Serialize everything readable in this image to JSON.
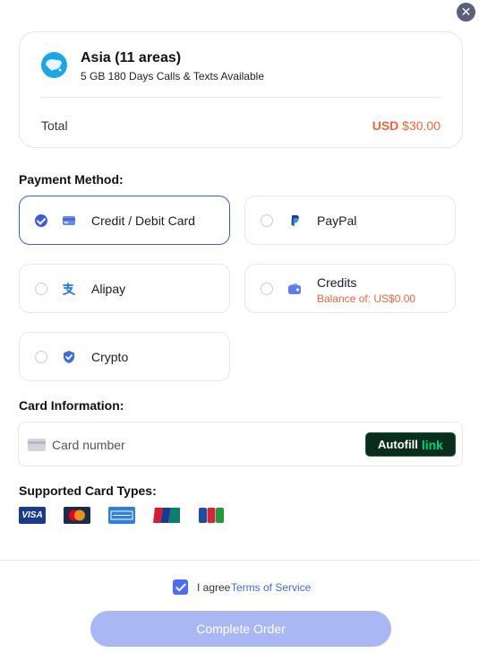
{
  "dialog": {
    "close_icon": "close-icon"
  },
  "summary": {
    "region_icon": "asia-map-icon",
    "region_title": "Asia (11 areas)",
    "plan_description": "5 GB 180 Days Calls & Texts Available",
    "total_label": "Total",
    "total_currency": "USD",
    "total_amount": "$30.00"
  },
  "payment": {
    "title": "Payment Method:",
    "methods": [
      {
        "label": "Credit / Debit Card",
        "icon": "credit-card-icon",
        "selected": true
      },
      {
        "label": "PayPal",
        "icon": "paypal-icon",
        "selected": false
      },
      {
        "label": "Alipay",
        "icon": "alipay-icon",
        "selected": false
      },
      {
        "label": "Credits",
        "sub_label": "Balance of: US$0.00",
        "icon": "wallet-icon",
        "selected": false
      },
      {
        "label": "Crypto",
        "icon": "shield-icon",
        "selected": false
      }
    ]
  },
  "card_info": {
    "title": "Card Information:",
    "placeholder": "Card number",
    "autofill_label": "Autofill",
    "autofill_brand": "link"
  },
  "card_types": {
    "title": "Supported Card Types:",
    "brands": [
      "VISA",
      "MasterCard",
      "AMERICAN EXPRESS",
      "UnionPay",
      "JCB"
    ]
  },
  "footer": {
    "agree_checked": true,
    "agree_text": "I agree",
    "terms_link": "Terms of Service",
    "complete_button": "Complete Order"
  },
  "colors": {
    "accent": "#3e5bd8",
    "price": "#f0643a",
    "button_disabled": "#a9b7f5",
    "link_brand": "#00d66f"
  }
}
